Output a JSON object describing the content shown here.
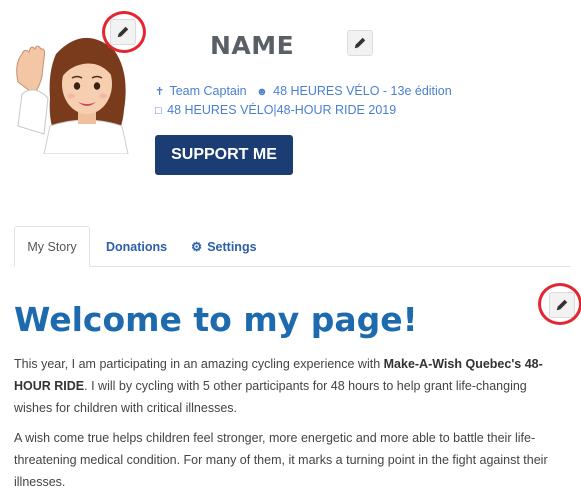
{
  "profile": {
    "name": "NAME",
    "role": "Team Captain",
    "team": "48 HEURES VÉLO - 13e édition",
    "event": "48 HEURES VÉLO|48-HOUR RIDE 2019",
    "support_label": "SUPPORT ME"
  },
  "tabs": [
    {
      "label": "My Story",
      "active": true
    },
    {
      "label": "Donations",
      "active": false
    },
    {
      "label": "Settings",
      "active": false
    }
  ],
  "story": {
    "title": "Welcome to my page!",
    "p1_a": "This year, I am participating in an amazing cycling experience with ",
    "p1_b": "Make-A-Wish Quebec's 48-HOUR RIDE",
    "p1_c": ". I will by cycling with 5 other participants for 48 hours to help grant life-changing wishes for children with critical illnesses.",
    "p2": "A wish come true helps children feel stronger, more energetic and more able to battle their life-threatening medical condition. For many of them, it marks a turning point in the fight against their illnesses."
  },
  "colors": {
    "accent": "#1d6aae",
    "button": "#1c3d73",
    "link": "#4a7fd0",
    "highlight_ring": "#e3262f"
  },
  "icons": [
    "pencil-icon",
    "user-icon",
    "team-icon",
    "calendar-icon",
    "gear-icon"
  ]
}
